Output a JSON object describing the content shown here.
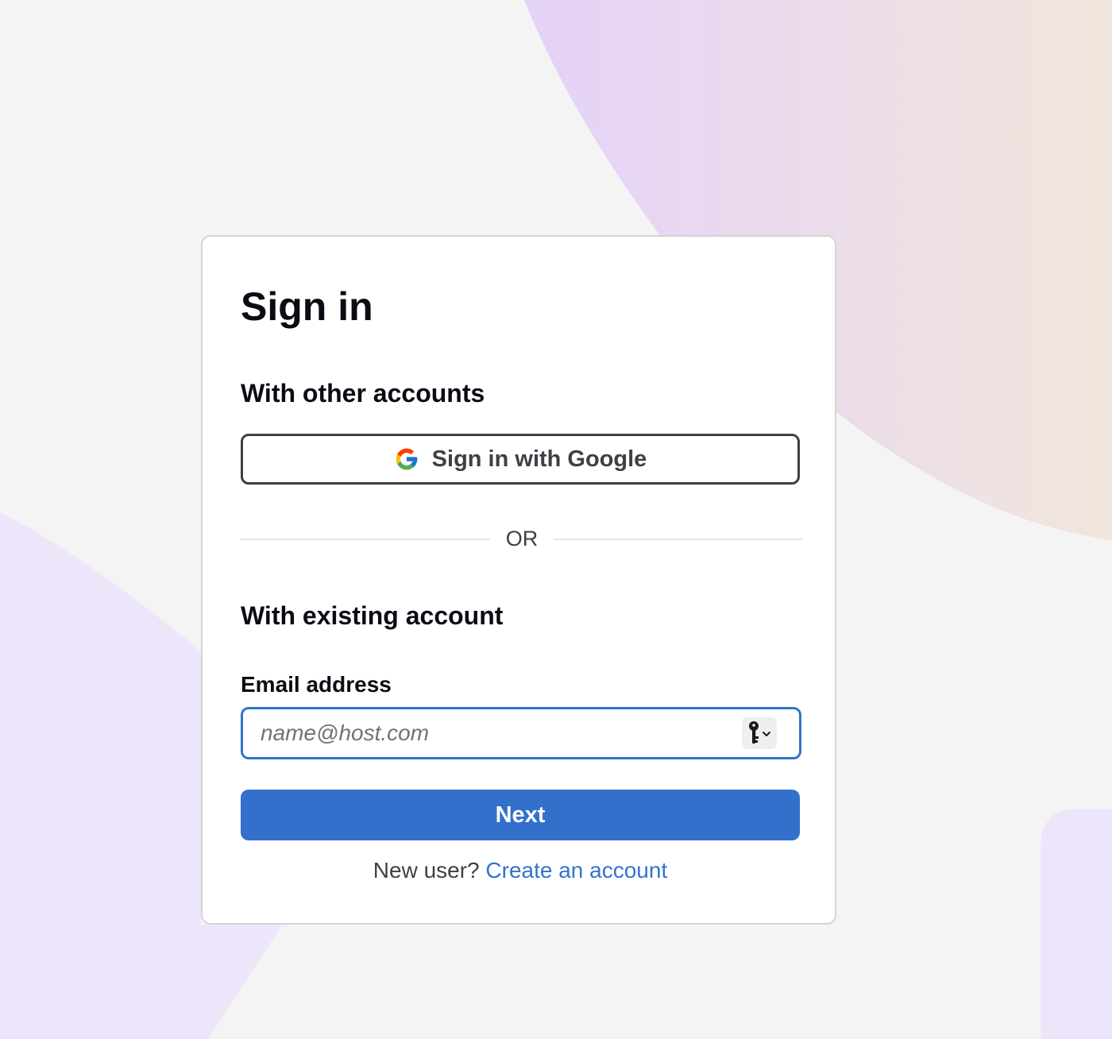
{
  "signin": {
    "title": "Sign in",
    "other_accounts_heading": "With other accounts",
    "google_button_label": "Sign in with Google",
    "divider_text": "OR",
    "existing_account_heading": "With existing account",
    "email_label": "Email address",
    "email_placeholder": "name@host.com",
    "email_value": "",
    "next_button_label": "Next",
    "new_user_prompt": "New user?",
    "create_account_link": "Create an account"
  },
  "icons": {
    "google": "google-g-logo",
    "password_manager": "key-icon"
  },
  "colors": {
    "primary": "#3370cc",
    "link": "#3373cc",
    "focus_border": "#3373cc",
    "heading_text": "#0b0b14",
    "body_text": "#3f3f46",
    "page_background": "#f4f4f4",
    "card_background": "#ffffff",
    "decor_purple": "#e4d4f8",
    "decor_peach": "#f0e4da",
    "decor_lavender": "#ede6fb"
  }
}
